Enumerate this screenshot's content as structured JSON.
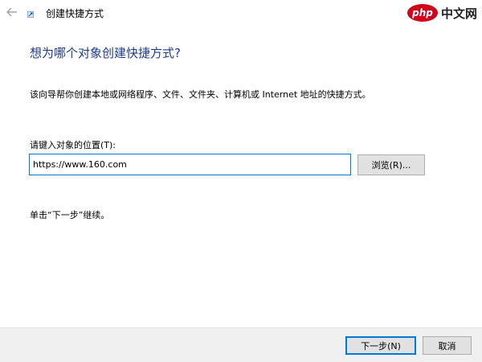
{
  "titlebar": {
    "title": "创建快捷方式",
    "back_icon": "back-arrow-icon",
    "app_icon": "shortcut-app-icon"
  },
  "watermark": {
    "logo_text": "php",
    "site_text": "中文网"
  },
  "wizard": {
    "heading": "想为哪个对象创建快捷方式?",
    "description": "该向导帮你创建本地或网络程序、文件、文件夹、计算机或 Internet 地址的快捷方式。",
    "location_label": "请键入对象的位置(T):",
    "location_value": "https://www.160.com",
    "browse_label": "浏览(R)...",
    "hint": "单击“下一步”继续。"
  },
  "footer": {
    "next_label": "下一步(N)",
    "cancel_label": "取消"
  },
  "colors": {
    "heading": "#1f3c8c",
    "focus_border": "#0078d7",
    "footer_bg": "#f0f0f0",
    "button_bg": "#e1e1e1"
  }
}
